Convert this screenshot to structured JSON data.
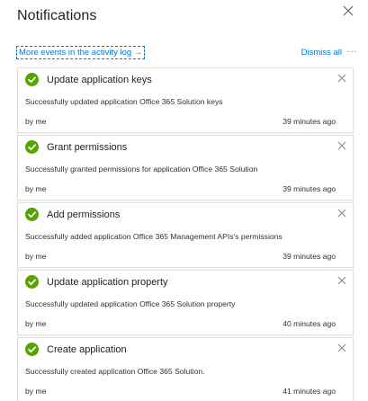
{
  "header": {
    "title": "Notifications"
  },
  "toolbar": {
    "activity_link": "More events in the activity log →",
    "dismiss_all": "Dismiss all",
    "more": "···"
  },
  "colors": {
    "success": "#57a300",
    "link": "#0078d4"
  },
  "icons": {
    "close": "close-icon",
    "success": "checkmark-circle-icon",
    "dismiss": "dismiss-icon"
  },
  "notifications": [
    {
      "title": "Update application keys",
      "description": "Successfully updated application Office 365 Solution keys",
      "by": "by me",
      "time": "39 minutes ago"
    },
    {
      "title": "Grant permissions",
      "description": "Successfully granted permissions for application Office 365 Solution",
      "by": "by me",
      "time": "39 minutes ago"
    },
    {
      "title": "Add permissions",
      "description": "Successfully added application Office 365 Management APIs's permissions",
      "by": "by me",
      "time": "39 minutes ago"
    },
    {
      "title": "Update application property",
      "description": "Successfully updated application Office 365 Solution property",
      "by": "by me",
      "time": "40 minutes ago"
    },
    {
      "title": "Create application",
      "description": "Successfully created application Office 365 Solution.",
      "by": "by me",
      "time": "41 minutes ago"
    }
  ]
}
